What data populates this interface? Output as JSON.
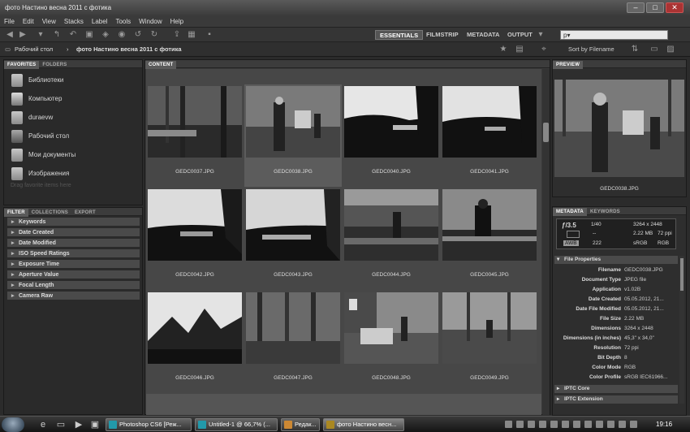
{
  "window": {
    "title": "фото Настино весна 2011 с фотика"
  },
  "menu": [
    "File",
    "Edit",
    "View",
    "Stacks",
    "Label",
    "Tools",
    "Window",
    "Help"
  ],
  "workspaces": {
    "essentials": "ESSENTIALS",
    "filmstrip": "FILMSTRIP",
    "metadata": "METADATA",
    "output": "OUTPUT"
  },
  "search": {
    "placeholder": "p▾"
  },
  "path": {
    "root": "Рабочий стол",
    "separator": "›",
    "current": "фото Настино весна 2011 с фотика"
  },
  "sort": {
    "label": "Sort by Filename"
  },
  "favorites": {
    "tabs": [
      "FAVORITES",
      "FOLDERS"
    ],
    "items": [
      {
        "label": "Библиотеки",
        "icon": "libraries-icon"
      },
      {
        "label": "Компьютер",
        "icon": "computer-icon"
      },
      {
        "label": "duraevw",
        "icon": "user-folder-icon"
      },
      {
        "label": "Рабочий стол",
        "icon": "desktop-icon"
      },
      {
        "label": "Мои документы",
        "icon": "documents-icon"
      },
      {
        "label": "Изображения",
        "icon": "pictures-icon"
      }
    ],
    "hint": "Drag favorite items here"
  },
  "filter": {
    "tabs": [
      "FILTER",
      "COLLECTIONS",
      "EXPORT"
    ],
    "rows": [
      "Keywords",
      "Date Created",
      "Date Modified",
      "ISO Speed Ratings",
      "Exposure Time",
      "Aperture Value",
      "Focal Length",
      "Camera Raw"
    ]
  },
  "content": {
    "tab": "CONTENT",
    "thumbs": [
      "GEDC0037.JPG",
      "GEDC0038.JPG",
      "GEDC0040.JPG",
      "GEDC0041.JPG",
      "GEDC0042.JPG",
      "GEDC0043.JPG",
      "GEDC0044.JPG",
      "GEDC0045.JPG",
      "GEDC0046.JPG",
      "GEDC0047.JPG",
      "GEDC0048.JPG",
      "GEDC0049.JPG"
    ],
    "selected": "GEDC0038.JPG"
  },
  "preview": {
    "tab": "PREVIEW",
    "caption": "GEDC0038.JPG"
  },
  "metadata": {
    "tabs": [
      "METADATA",
      "KEYWORDS"
    ],
    "header": {
      "fstop": "ƒ/3.5",
      "shutter": "1/40",
      "dims": "3264 x 2448",
      "dash1": "--",
      "dash2": "--",
      "size": "2.22 MB",
      "ppi": "72 ppi",
      "iso": "222",
      "colorspace": "sRGB",
      "mode": "RGB"
    },
    "section_file": "File Properties",
    "rows": [
      {
        "k": "Filename",
        "v": "GEDC0038.JPG"
      },
      {
        "k": "Document Type",
        "v": "JPEG file"
      },
      {
        "k": "Application",
        "v": "v1.02B"
      },
      {
        "k": "Date Created",
        "v": "05.05.2012, 21..."
      },
      {
        "k": "Date File Modified",
        "v": "05.05.2012, 21..."
      },
      {
        "k": "File Size",
        "v": "2.22 MB"
      },
      {
        "k": "Dimensions",
        "v": "3264 x 2448"
      },
      {
        "k": "Dimensions (in inches)",
        "v": "45,3\" x 34,0\""
      },
      {
        "k": "Resolution",
        "v": "72 ppi"
      },
      {
        "k": "Bit Depth",
        "v": "8"
      },
      {
        "k": "Color Mode",
        "v": "RGB"
      },
      {
        "k": "Color Profile",
        "v": "sRGB IEC61966..."
      }
    ],
    "section_iptc": "IPTC Core",
    "section_iptc_ext": "IPTC Extension"
  },
  "taskbar": {
    "tasks": [
      "Photoshop CS6 [Реж...",
      "Untitled-1 @ 66,7% (...",
      "Редак...",
      "фото Настино весн..."
    ],
    "clock": "19:16"
  }
}
